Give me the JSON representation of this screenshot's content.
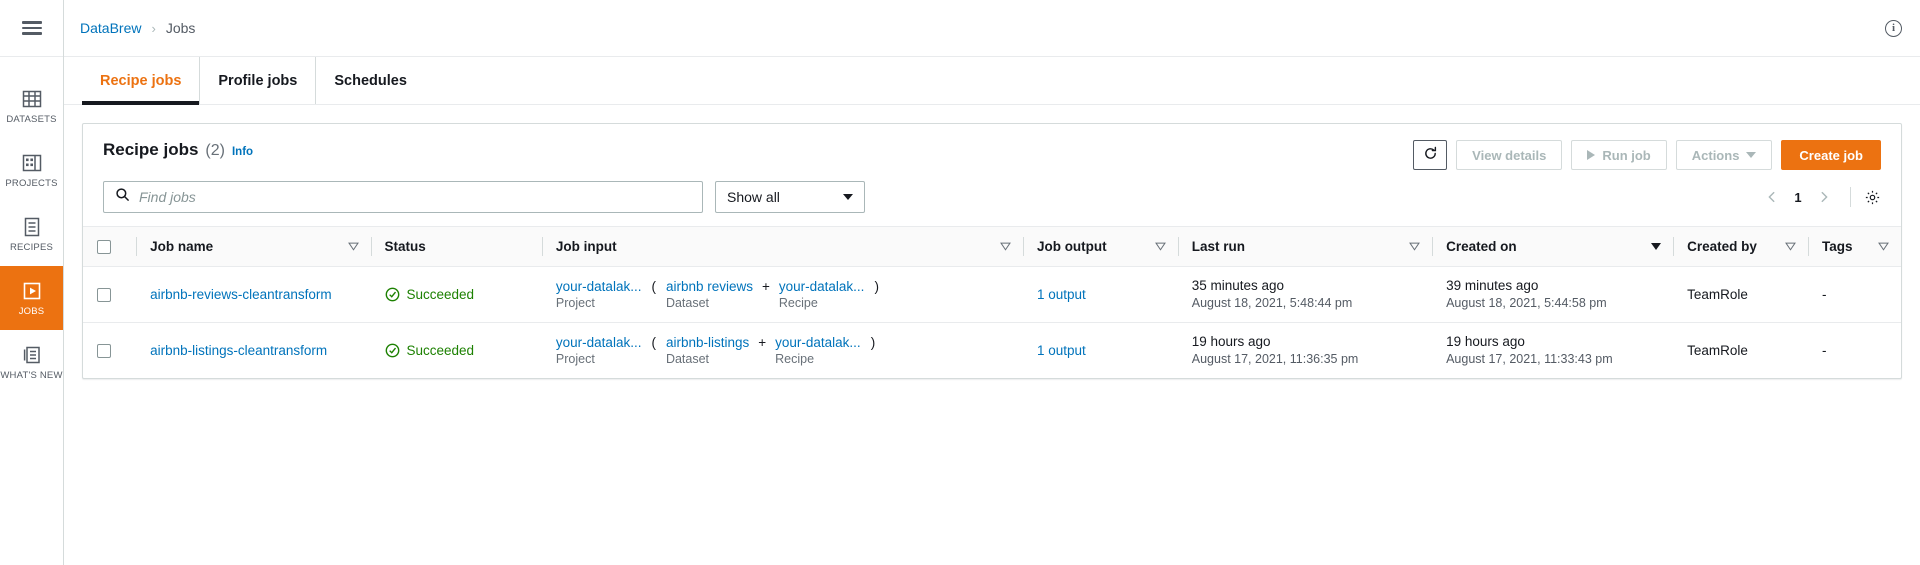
{
  "sidebar": {
    "menu_icon": "hamburger-icon",
    "items": [
      {
        "id": "datasets",
        "label": "DATASETS",
        "icon": "datasets-grid-icon",
        "active": false
      },
      {
        "id": "projects",
        "label": "PROJECTS",
        "icon": "projects-icon",
        "active": false
      },
      {
        "id": "recipes",
        "label": "RECIPES",
        "icon": "recipes-list-icon",
        "active": false
      },
      {
        "id": "jobs",
        "label": "JOBS",
        "icon": "jobs-play-icon",
        "active": true
      },
      {
        "id": "whats-new",
        "label": "WHAT'S NEW",
        "icon": "whats-new-icon",
        "active": false
      }
    ],
    "active_bg": "#ec7211"
  },
  "topbar": {
    "breadcrumb": {
      "root": "DataBrew",
      "separator": "›",
      "current": "Jobs"
    },
    "info_icon": "info-circle-icon"
  },
  "tabs": [
    {
      "id": "recipe-jobs",
      "label": "Recipe jobs",
      "active": true
    },
    {
      "id": "profile-jobs",
      "label": "Profile jobs",
      "active": false
    },
    {
      "id": "schedules",
      "label": "Schedules",
      "active": false
    }
  ],
  "panel": {
    "title": "Recipe jobs",
    "count": "(2)",
    "info_label": "Info",
    "toolbar": {
      "refresh_icon": "refresh-icon",
      "view_details_label": "View details",
      "run_job_label": "Run job",
      "run_job_icon": "play-icon",
      "actions_label": "Actions",
      "actions_icon": "chevron-down-icon",
      "create_job_label": "Create job",
      "primary_color": "#ec7211"
    },
    "search": {
      "placeholder": "Find jobs",
      "value": "",
      "icon": "search-icon"
    },
    "filter_select": {
      "value": "Show all",
      "icon": "chevron-down-icon"
    },
    "pagination": {
      "prev_icon": "chevron-left-icon",
      "page": "1",
      "next_icon": "chevron-right-icon",
      "settings_icon": "gear-icon"
    }
  },
  "table": {
    "select_all_label": "select-all-checkbox",
    "columns": [
      {
        "id": "job-name",
        "label": "Job name",
        "sort": "hollow"
      },
      {
        "id": "status",
        "label": "Status",
        "sort": "none"
      },
      {
        "id": "job-input",
        "label": "Job input",
        "sort": "hollow"
      },
      {
        "id": "job-output",
        "label": "Job output",
        "sort": "hollow"
      },
      {
        "id": "last-run",
        "label": "Last run",
        "sort": "hollow"
      },
      {
        "id": "created-on",
        "label": "Created on",
        "sort": "solid"
      },
      {
        "id": "created-by",
        "label": "Created by",
        "sort": "hollow"
      },
      {
        "id": "tags",
        "label": "Tags",
        "sort": "hollow"
      }
    ],
    "rows": [
      {
        "job_name": "airbnb-reviews-cleantransform",
        "status": "Succeeded",
        "status_icon": "check-circle-icon",
        "status_color": "#1d8102",
        "input": {
          "project": {
            "name": "your-datalak...",
            "sub": "Project"
          },
          "open_paren": "(",
          "dataset": {
            "name": "airbnb reviews",
            "sub": "Dataset"
          },
          "plus": "+",
          "recipe": {
            "name": "your-datalak...",
            "sub": "Recipe"
          },
          "close_paren": ")"
        },
        "job_output": "1 output",
        "last_run_rel": "35 minutes ago",
        "last_run_abs": "August 18, 2021, 5:48:44 pm",
        "created_rel": "39 minutes ago",
        "created_abs": "August 18, 2021, 5:44:58 pm",
        "created_by": "TeamRole",
        "tags": "-"
      },
      {
        "job_name": "airbnb-listings-cleantransform",
        "status": "Succeeded",
        "status_icon": "check-circle-icon",
        "status_color": "#1d8102",
        "input": {
          "project": {
            "name": "your-datalak...",
            "sub": "Project"
          },
          "open_paren": "(",
          "dataset": {
            "name": "airbnb-listings",
            "sub": "Dataset"
          },
          "plus": "+",
          "recipe": {
            "name": "your-datalak...",
            "sub": "Recipe"
          },
          "close_paren": ")"
        },
        "job_output": "1 output",
        "last_run_rel": "19 hours ago",
        "last_run_abs": "August 17, 2021, 11:36:35 pm",
        "created_rel": "19 hours ago",
        "created_abs": "August 17, 2021, 11:33:43 pm",
        "created_by": "TeamRole",
        "tags": "-"
      }
    ]
  }
}
